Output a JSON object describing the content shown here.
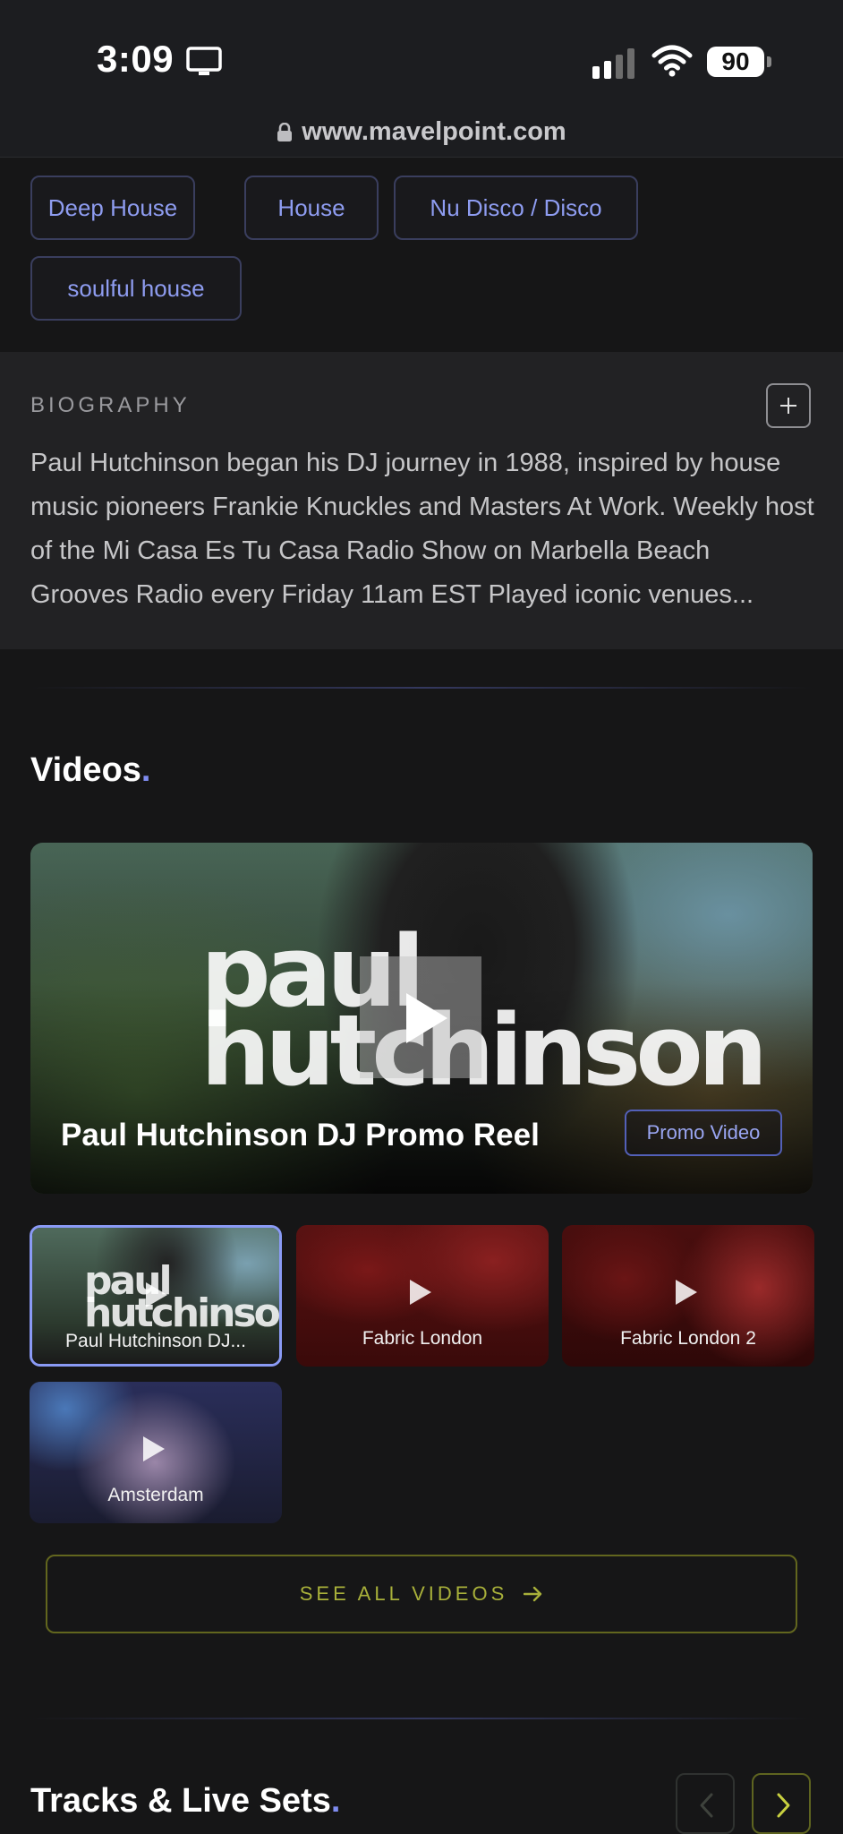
{
  "status_bar": {
    "time": "3:09",
    "battery": "90"
  },
  "browser": {
    "url": "www.mavelpoint.com"
  },
  "genres": [
    "Deep House",
    "House",
    "Nu Disco / Disco",
    "soulful house"
  ],
  "biography": {
    "title": "BIOGRAPHY",
    "text": "Paul Hutchinson began his DJ journey in 1988, inspired by house music pioneers Frankie Knuckles and Masters At Work. Weekly host of the Mi Casa Es Tu Casa Radio Show on Marbella Beach Grooves Radio every Friday 11am EST Played iconic venues..."
  },
  "videos": {
    "title": "Videos",
    "featured": {
      "title": "Paul Hutchinson DJ Promo Reel",
      "badge": "Promo Video",
      "wordmark_line1": "paul",
      "wordmark_line2": "hutchinson"
    },
    "items": [
      {
        "label": "Paul Hutchinson DJ...",
        "active": true
      },
      {
        "label": "Fabric London",
        "active": false
      },
      {
        "label": "Fabric London 2",
        "active": false
      },
      {
        "label": "Amsterdam",
        "active": false
      }
    ],
    "see_all": "SEE ALL VIDEOS"
  },
  "tracks": {
    "title": "Tracks & Live Sets"
  },
  "colors": {
    "accent": "#7f8cf0",
    "lime": "#a8b03a",
    "chip_text": "#8e9cf0"
  }
}
